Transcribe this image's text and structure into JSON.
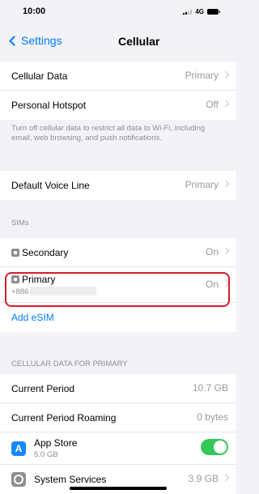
{
  "status": {
    "time": "10:00",
    "network": "4G"
  },
  "nav": {
    "back_label": "Settings",
    "title": "Cellular"
  },
  "rows": {
    "cellular_data": {
      "label": "Cellular Data",
      "value": "Primary"
    },
    "personal_hotspot": {
      "label": "Personal Hotspot",
      "value": "Off"
    },
    "default_voice_line": {
      "label": "Default Voice Line",
      "value": "Primary"
    }
  },
  "notes": {
    "cellular_off": "Turn off cellular data to restrict all data to Wi-Fi, including email, web browsing, and push notifications."
  },
  "sims": {
    "header": "SIMs",
    "secondary": {
      "label": "Secondary",
      "value": "On"
    },
    "primary": {
      "label": "Primary",
      "phone_prefix": "+886",
      "value": "On"
    },
    "add_esim": "Add eSIM"
  },
  "usage": {
    "header": "CELLULAR DATA FOR PRIMARY",
    "current_period": {
      "label": "Current Period",
      "value": "10.7 GB"
    },
    "current_period_roaming": {
      "label": "Current Period Roaming",
      "value": "0 bytes"
    },
    "app_store": {
      "label": "App Store",
      "usage": "5.0 GB"
    },
    "system_services": {
      "label": "System Services",
      "value": "3.9 GB"
    }
  },
  "accent": {
    "blue": "#007aff",
    "green": "#34c759",
    "highlight_red": "#d91b2a"
  }
}
